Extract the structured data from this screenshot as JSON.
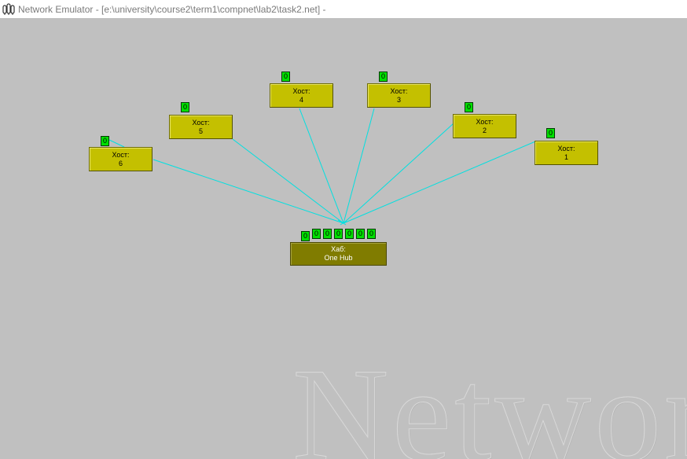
{
  "window": {
    "title": "Network Emulator - [e:\\university\\course2\\term1\\compnet\\lab2\\task2.net] -",
    "icon": "app-icon"
  },
  "colors": {
    "background": "#c0c0c0",
    "host": "#c4c000",
    "hub": "#807c00",
    "port": "#00e000",
    "link": "#00e0e0"
  },
  "hub": {
    "type": "Хаб:",
    "name": "One Hub",
    "ports": [
      "0",
      "0",
      "0",
      "0",
      "0",
      "0",
      "0"
    ]
  },
  "hosts": [
    {
      "type": "Хост:",
      "name": "1",
      "port": "0"
    },
    {
      "type": "Хост:",
      "name": "2",
      "port": "0"
    },
    {
      "type": "Хост:",
      "name": "3",
      "port": "0"
    },
    {
      "type": "Хост:",
      "name": "4",
      "port": "0"
    },
    {
      "type": "Хост:",
      "name": "5",
      "port": "0"
    },
    {
      "type": "Хост:",
      "name": "6",
      "port": "0"
    }
  ],
  "watermark": "Network"
}
